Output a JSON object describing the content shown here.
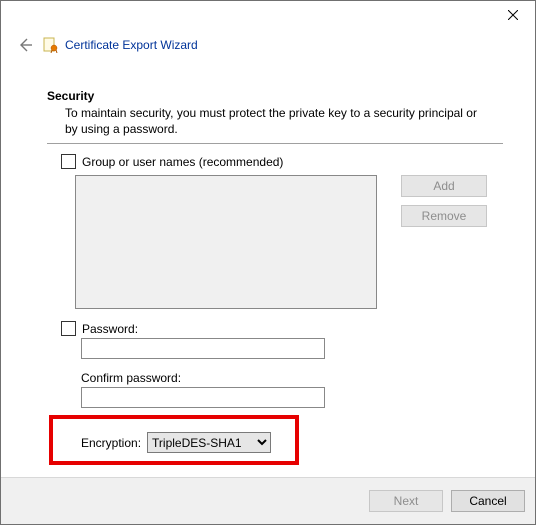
{
  "header": {
    "title": "Certificate Export Wizard"
  },
  "section": {
    "title": "Security",
    "description": "To maintain security, you must protect the private key to a security principal or by using a password."
  },
  "group": {
    "checkbox_label": "Group or user names (recommended)",
    "add_label": "Add",
    "remove_label": "Remove"
  },
  "password": {
    "checkbox_label": "Password:",
    "value": "",
    "confirm_label": "Confirm password:",
    "confirm_value": ""
  },
  "encryption": {
    "label": "Encryption:",
    "value": "TripleDES-SHA1"
  },
  "footer": {
    "next": "Next",
    "cancel": "Cancel"
  }
}
